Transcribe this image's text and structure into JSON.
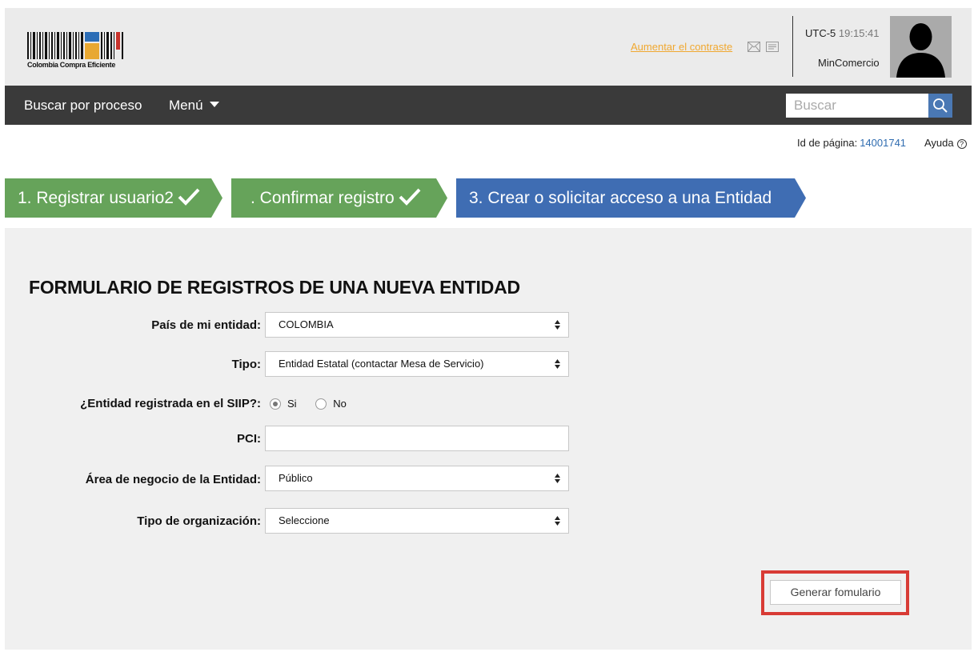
{
  "header": {
    "logo_text": "Colombia Compra Eficiente",
    "contrast_link": "Aumentar el contraste",
    "icons": [
      "mail-icon",
      "document-icon"
    ],
    "timezone": "UTC-5",
    "time": "19:15:41",
    "user_name": "MinComercio"
  },
  "nav": {
    "search_process": "Buscar por proceso",
    "menu": "Menú",
    "search_placeholder": "Buscar"
  },
  "page_info": {
    "page_id_label": "Id de página:",
    "page_id_value": "14001741",
    "help_label": "Ayuda",
    "help_icon": "?"
  },
  "steps": [
    {
      "label": "1. Registrar usuario2",
      "status": "done",
      "color": "#66a35a"
    },
    {
      "label": ". Confirmar registro",
      "status": "done",
      "color": "#66a35a"
    },
    {
      "label": "3. Crear o solicitar acceso a una Entidad",
      "status": "active",
      "color": "#3f6db3"
    }
  ],
  "form": {
    "title": "FORMULARIO DE REGISTROS DE UNA NUEVA ENTIDAD",
    "country_label": "País de mi entidad:",
    "country_value": "COLOMBIA",
    "type_label": "Tipo:",
    "type_value": "Entidad Estatal (contactar Mesa de Servicio)",
    "siip_label": "¿Entidad registrada en el SIIP?:",
    "siip_options": [
      "Si",
      "No"
    ],
    "siip_selected": "Si",
    "pci_label": "PCI:",
    "pci_value": "",
    "business_area_label": "Área de negocio de la Entidad:",
    "business_area_value": "Público",
    "org_type_label": "Tipo de organización:",
    "org_type_value": "Seleccione",
    "generate_button": "Generar fomulario"
  },
  "colors": {
    "accent_blue": "#3f6db3",
    "step_green": "#66a35a",
    "navbar": "#3a3a3a",
    "highlight_red": "#d83b35",
    "contrast_link": "#f0a830"
  }
}
